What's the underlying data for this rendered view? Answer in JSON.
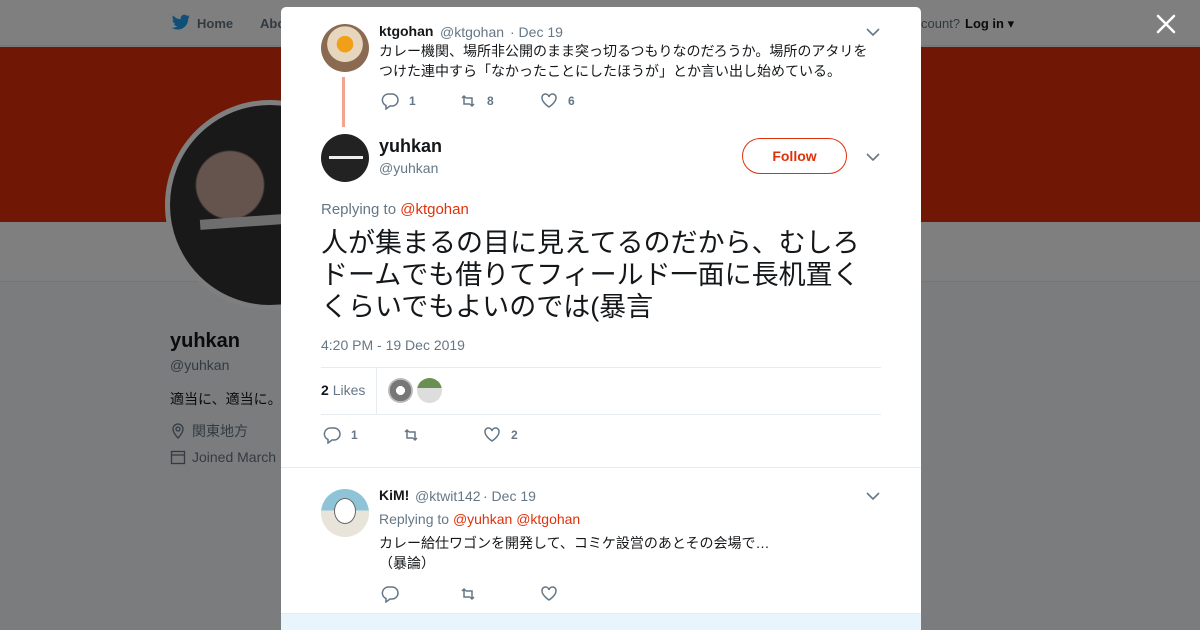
{
  "nav": {
    "home": "Home",
    "about": "Abo",
    "account_prompt": "count?",
    "login": "Log in"
  },
  "profile": {
    "name": "yuhkan",
    "handle": "@yuhkan",
    "bio": "適当に、適当に。",
    "location": "関東地方",
    "joined": "Joined March"
  },
  "colors": {
    "accent": "#e0310b",
    "thread_line": "#f5a48f",
    "muted": "#657786"
  },
  "parent_tweet": {
    "name": "ktgohan",
    "handle": "@ktgohan",
    "date": "· Dec 19",
    "text_line1": "カレー機関、場所非公開のまま突っ切るつもりなのだろうか。場所のアタリを",
    "text_line2": "つけた連中すら「なかったことにしたほうが」とか言い出し始めている。",
    "replies": "1",
    "retweets": "8",
    "likes": "6"
  },
  "main_tweet": {
    "name": "yuhkan",
    "handle": "@yuhkan",
    "follow_label": "Follow",
    "replying_prefix": "Replying to ",
    "replying_to": "@ktgohan",
    "text": "人が集まるの目に見えてるのだから、むしろドームでも借りてフィールド一面に長机置くくらいでもよいのでは(暴言",
    "timestamp": "4:20 PM - 19 Dec 2019",
    "likes_count": "2",
    "likes_label": "Likes",
    "replies": "1",
    "retweets": "",
    "likes": "2"
  },
  "reply_tweet": {
    "name": "KiM!",
    "handle": "@ktwit142",
    "date": "· Dec 19",
    "replying_prefix": "Replying to ",
    "replying_to_1": "@yuhkan",
    "replying_to_2": "@ktgohan",
    "text_line1": "カレー給仕ワゴンを開発して、コミケ設営のあとその会場で…",
    "text_line2": "（暴論）"
  },
  "icons": [
    "twitter-bird-icon",
    "close-icon",
    "chevron-down-icon",
    "reply-icon",
    "retweet-icon",
    "heart-icon",
    "location-pin-icon",
    "calendar-icon"
  ]
}
